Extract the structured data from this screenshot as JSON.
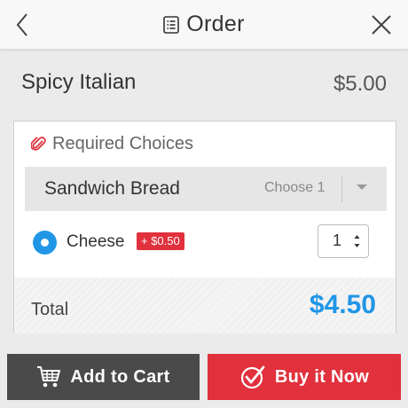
{
  "header": {
    "title": "Order",
    "back_icon": "chevron-left-icon",
    "close_icon": "close-icon",
    "title_icon": "receipt-icon"
  },
  "item": {
    "name": "Spicy Italian",
    "price": "$5.00"
  },
  "required": {
    "label": "Required Choices",
    "icon": "paperclip-icon",
    "icon_color": "#e0313d",
    "group": {
      "name": "Sandwich Bread",
      "choose": "Choose 1"
    },
    "option": {
      "label": "Cheese",
      "badge": "+ $0.50",
      "quantity": "1",
      "selected": true
    }
  },
  "total": {
    "label": "Total",
    "value": "$4.50"
  },
  "footer": {
    "add_to_cart": "Add to Cart",
    "buy_now": "Buy it Now"
  },
  "colors": {
    "accent_blue": "#2196e6",
    "accent_red": "#e0313d",
    "dark_button": "#4a4a4a"
  }
}
